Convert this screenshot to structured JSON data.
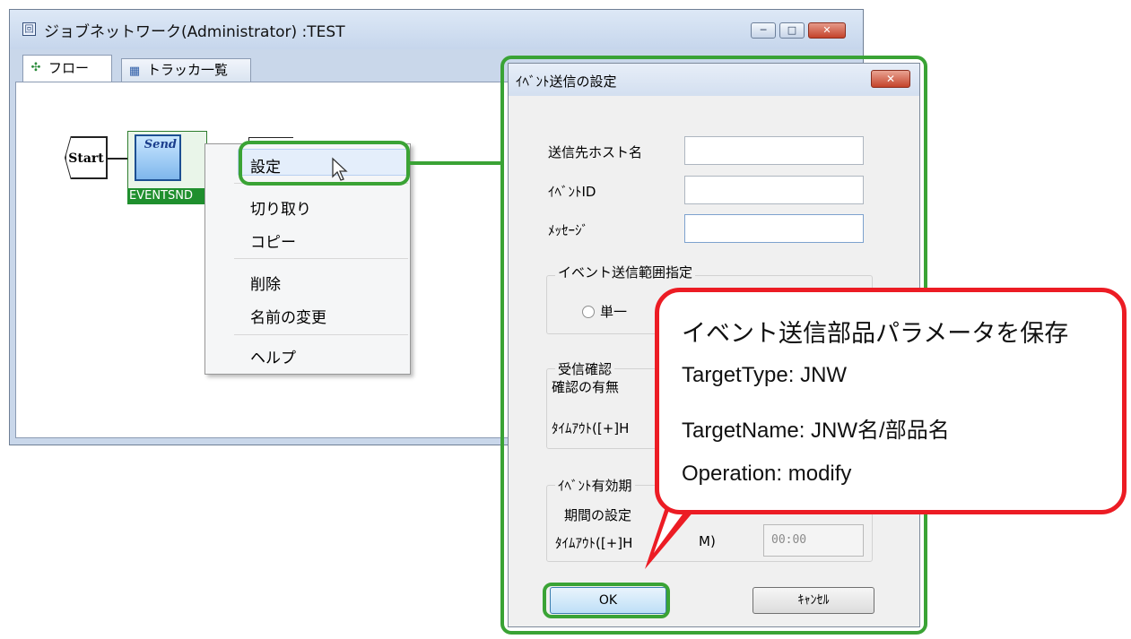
{
  "main_window": {
    "title": "ジョブネットワーク(Administrator) :TEST",
    "title_icon": "window-icon",
    "controls": {
      "minimize": "─",
      "maximize": "□",
      "close": "✕"
    },
    "tabs": [
      {
        "label": "フロー",
        "icon": "flow-icon"
      },
      {
        "label": "トラッカ一覧",
        "icon": "tracker-icon"
      }
    ]
  },
  "flow": {
    "start_label": "Start",
    "part_icon_text": "Send",
    "part_label": "EVENTSND"
  },
  "context_menu": {
    "items": [
      "設定",
      "切り取り",
      "コピー",
      "削除",
      "名前の変更",
      "ヘルプ"
    ]
  },
  "dialog": {
    "title": "ｲﾍﾞﾝﾄ送信の設定",
    "close": "✕",
    "fields": {
      "host_label": "送信先ホスト名",
      "host_value": "",
      "event_id_label": "ｲﾍﾞﾝﾄID",
      "event_id_value": "",
      "message_label": "ﾒｯｾｰｼﾞ",
      "message_value": ""
    },
    "range_group": {
      "title": "イベント送信範囲指定",
      "radio_single": "単一"
    },
    "confirm_group": {
      "title": "受信確認",
      "has_confirm": "確認の有無",
      "timeout": "ﾀｲﾑｱｳﾄ([+]H"
    },
    "valid_group": {
      "title": "ｲﾍﾞﾝﾄ有効期",
      "period": "期間の設定",
      "timeout": "ﾀｲﾑｱｳﾄ([+]H",
      "timeout_suffix": "M)",
      "time_value": "00:00"
    },
    "buttons": {
      "ok": "OK",
      "cancel": "ｷｬﾝｾﾙ"
    }
  },
  "callout": {
    "lines": [
      "イベント送信部品パラメータを保存",
      "TargetType: JNW",
      "TargetName: JNW名/部品名",
      "Operation: modify"
    ],
    "border_color": "#ec1c24",
    "highlight_color": "#3aa335"
  }
}
